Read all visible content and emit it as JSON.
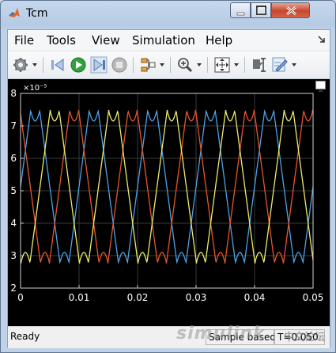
{
  "window": {
    "title": "Tcm"
  },
  "menu": [
    "File",
    "Tools",
    "View",
    "Simulation",
    "Help"
  ],
  "toolbar": {
    "icons": [
      "gear-icon",
      "step-back-icon",
      "run-icon",
      "step-forward-icon",
      "stop-icon",
      "signal-selector-icon",
      "zoom-icon",
      "fit-to-view-icon",
      "cursor-measure-icon",
      "style-edit-icon"
    ]
  },
  "status": {
    "left": "Ready",
    "sample": "Sample based",
    "time": "T=0.050"
  },
  "watermark": {
    "brand": "simulink",
    "site": "中文论坛"
  },
  "colors": {
    "background": "#000000",
    "axes": "#ffffff",
    "phase_a": "#4da3e8",
    "phase_b": "#e8562c",
    "phase_c": "#eded6c"
  },
  "chart_data": {
    "type": "line",
    "title": "",
    "xlabel": "",
    "ylabel": "",
    "xlim": [
      0,
      0.05
    ],
    "ylim": [
      2,
      8
    ],
    "y_exponent_label": "×10⁻⁵",
    "xticks": [
      "0",
      "0.01",
      "0.02",
      "0.03",
      "0.04",
      "0.05"
    ],
    "yticks": [
      "2",
      "3",
      "4",
      "5",
      "6",
      "7",
      "8"
    ],
    "grid": true,
    "series": [
      {
        "color": "#4da3e8",
        "period": 0.01,
        "phase": 0.0,
        "min": 2.75,
        "max": 7.5,
        "offset": 7.0
      },
      {
        "color": "#e8562c",
        "period": 0.01,
        "phase": 0.00333,
        "min": 2.75,
        "max": 7.5
      },
      {
        "color": "#eded6c",
        "period": 0.01,
        "phase": 0.00667,
        "min": 2.75,
        "max": 7.5
      }
    ]
  }
}
